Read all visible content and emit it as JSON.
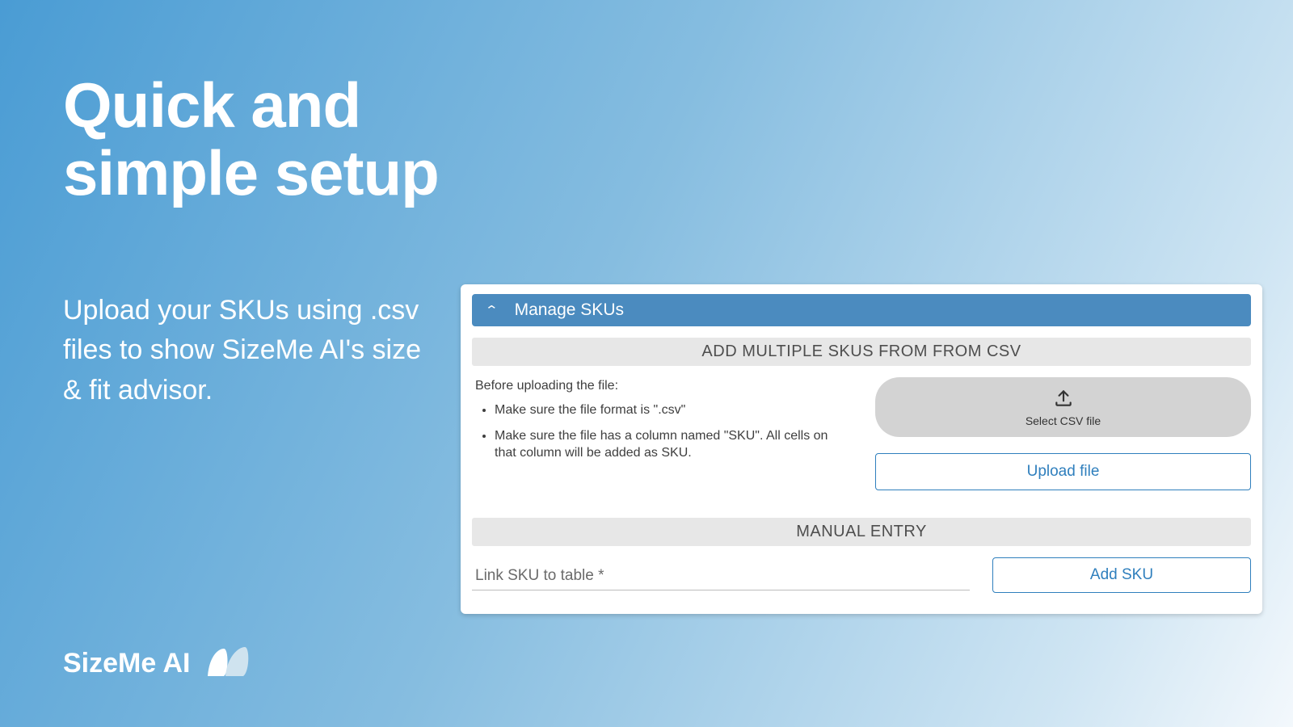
{
  "hero": {
    "title_line1": "Quick and",
    "title_line2": "simple setup",
    "subline": "Upload your SKUs using .csv files to show SizeMe AI's size & fit advisor."
  },
  "brand": {
    "name": "SizeMe AI"
  },
  "panel": {
    "header": "Manage SKUs",
    "csv": {
      "section_title": "ADD MULTIPLE SKUS FROM FROM CSV",
      "intro": "Before uploading the file:",
      "bullet1": "Make sure the file format is \".csv\"",
      "bullet2": "Make sure the file has a column named \"SKU\". All cells on that column will be added as SKU.",
      "select_label": "Select CSV file",
      "upload_label": "Upload file"
    },
    "manual": {
      "section_title": "MANUAL ENTRY",
      "input_placeholder": "Link SKU to table *",
      "add_label": "Add SKU"
    }
  }
}
